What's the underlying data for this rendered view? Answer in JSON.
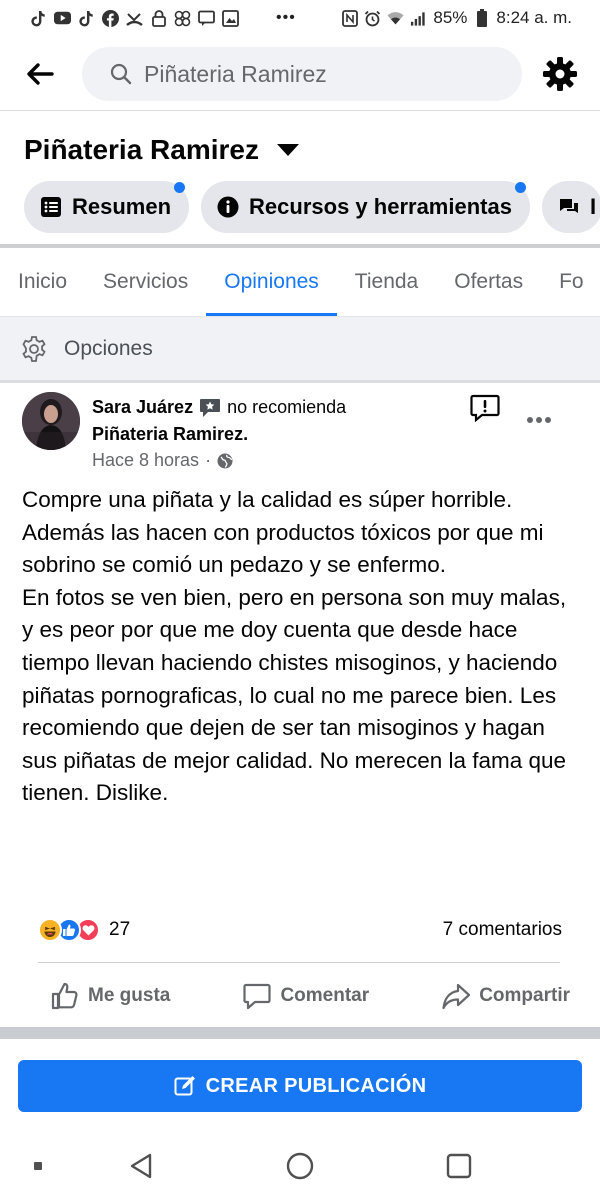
{
  "status_bar": {
    "icons": [
      "tiktok-icon",
      "youtube-icon",
      "tiktok-icon",
      "facebook-icon",
      "missed-call-icon",
      "lock-icon",
      "pinwheel-icon",
      "message-icon",
      "photo-icon"
    ],
    "more": "•••",
    "battery": "85%",
    "time": "8:24 a. m."
  },
  "header": {
    "search_text": "Piñateria Ramirez"
  },
  "page": {
    "title": "Piñateria Ramirez"
  },
  "chips": [
    {
      "label": "Resumen",
      "icon": "list-icon",
      "has_dot": true
    },
    {
      "label": "Recursos y herramientas",
      "icon": "info-icon",
      "has_dot": true
    },
    {
      "label": "I",
      "icon": "chat-icon",
      "has_dot": false
    }
  ],
  "tabs": [
    {
      "label": "Inicio",
      "active": false
    },
    {
      "label": "Servicios",
      "active": false
    },
    {
      "label": "Opiniones",
      "active": true
    },
    {
      "label": "Tienda",
      "active": false
    },
    {
      "label": "Ofertas",
      "active": false
    },
    {
      "label": "Fo",
      "active": false
    }
  ],
  "options": {
    "label": "Opciones"
  },
  "post": {
    "author": "Sara Juárez",
    "recommendation": "no recomienda",
    "page_name": "Piñateria Ramirez.",
    "time": "Hace 8 horas",
    "separator": "·",
    "paragraphs": [
      "Compre una piñata y la calidad es súper horrible. Además las hacen con productos tóxicos por que mi sobrino se comió un pedazo y se enfermo.",
      "En fotos se ven bien, pero en persona son muy malas, y es peor por que me doy cuenta que desde hace tiempo llevan haciendo chistes misoginos, y haciendo piñatas pornograficas, lo cual no me parece bien. Les recomiendo que dejen de ser tan misoginos y hagan sus piñatas de mejor calidad. No merecen la fama que tienen. Dislike."
    ],
    "reaction_count": "27",
    "comments_count": "7 comentarios"
  },
  "actions": {
    "like": "Me gusta",
    "comment": "Comentar",
    "share": "Compartir"
  },
  "create_post": {
    "label": "CREAR PUBLICACIÓN"
  },
  "colors": {
    "accent": "#1877f2",
    "secondary_text": "#65676b"
  }
}
